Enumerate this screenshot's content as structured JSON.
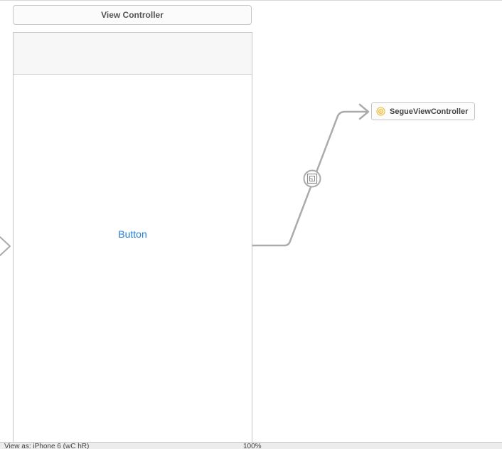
{
  "scene": {
    "title": "View Controller",
    "button_label": "Button"
  },
  "destination": {
    "label": "SegueViewController",
    "icon": "view-controller-icon"
  },
  "segue": {
    "icon": "segue-modal-icon"
  },
  "bottom_bar": {
    "device_label": "View as: iPhone 6 (wC hR)",
    "zoom_label": "100%"
  },
  "colors": {
    "accent": "#1d7ff0",
    "segue_line": "#ababab",
    "vc_icon": "#f5b323"
  }
}
